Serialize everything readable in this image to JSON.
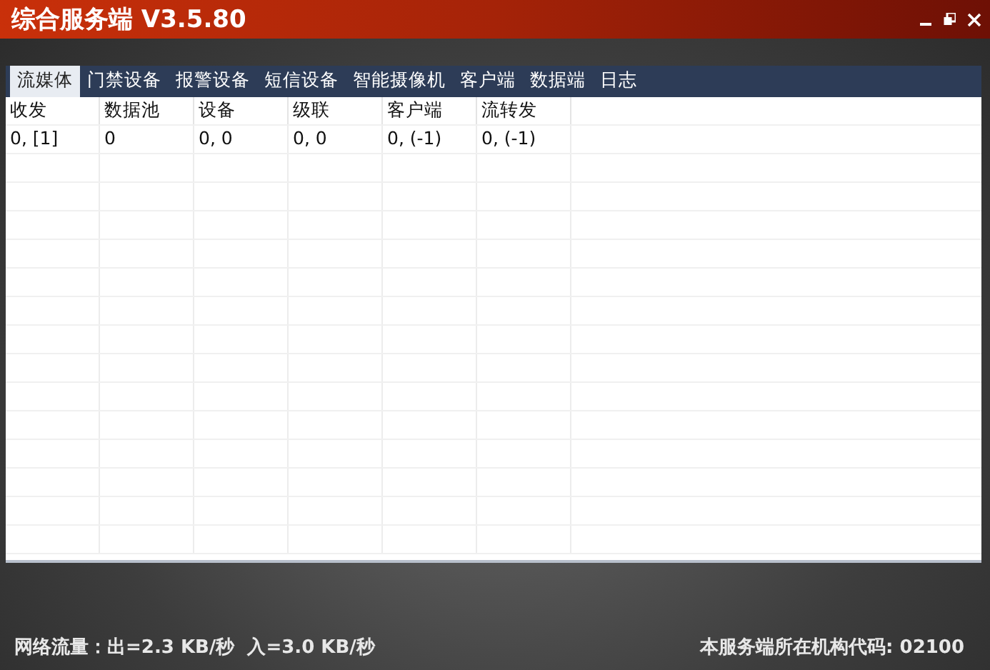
{
  "window": {
    "title": "综合服务端 V3.5.80"
  },
  "tabs": [
    {
      "label": "流媒体",
      "selected": true
    },
    {
      "label": "门禁设备",
      "selected": false
    },
    {
      "label": "报警设备",
      "selected": false
    },
    {
      "label": "短信设备",
      "selected": false
    },
    {
      "label": "智能摄像机",
      "selected": false
    },
    {
      "label": "客户端",
      "selected": false
    },
    {
      "label": "数据端",
      "selected": false
    },
    {
      "label": "日志",
      "selected": false
    }
  ],
  "table": {
    "columns": [
      "收发",
      "数据池",
      "设备",
      "级联",
      "客户端",
      "流转发"
    ],
    "rows": [
      [
        "0, [1]",
        "0",
        "0, 0",
        "0, 0",
        "0, (-1)",
        "0, (-1)"
      ]
    ]
  },
  "status_bar": {
    "traffic": "网络流量：出=2.3 KB/秒  入=3.0 KB/秒",
    "org_code": "本服务端所在机构代码: 02100"
  }
}
